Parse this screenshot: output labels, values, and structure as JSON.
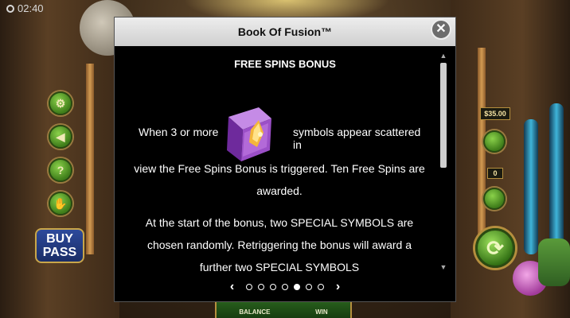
{
  "status": {
    "time": "02:40"
  },
  "game": {
    "buy_pass": [
      "BUY",
      "PASS"
    ],
    "bet_value": "$35.00",
    "lines_value": "0",
    "bottom_labels": {
      "balance": "BALANCE",
      "win": "WIN"
    }
  },
  "dialog": {
    "title": "Book Of Fusion™",
    "close_glyph": "✕",
    "section_title": "FREE SPINS BONUS",
    "line1_left": "When 3 or more",
    "line1_right": "symbols appear scattered in",
    "line2": "view the Free Spins Bonus is triggered. Ten Free Spins are",
    "line3": "awarded.",
    "line4": "At the start of the bonus, two SPECIAL SYMBOLS are",
    "line5": "chosen randomly. Retriggering the bonus will award a",
    "line6": "further two SPECIAL SYMBOLS",
    "icon": "book-symbol-icon",
    "pager": {
      "prev": "‹",
      "next": "›",
      "page_count": 7,
      "active_page": 5
    }
  },
  "colors": {
    "header_bg": "#e3e3e3",
    "dialog_bg": "#000000",
    "button_green": "#5da82a",
    "book_purple": "#9b4fc7"
  }
}
